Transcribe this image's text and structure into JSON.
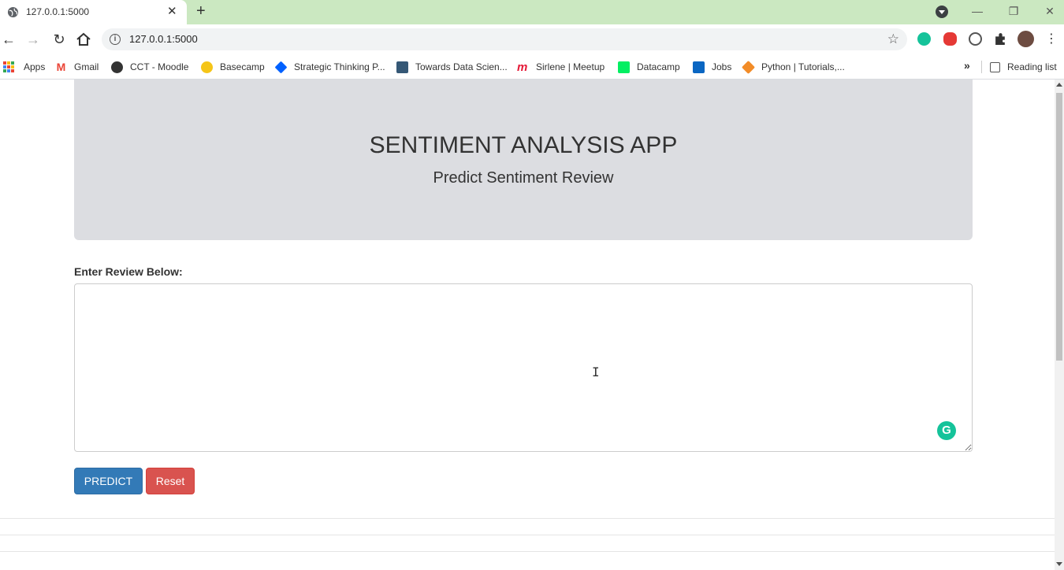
{
  "browser": {
    "tab_title": "127.0.0.1:5000",
    "url": "127.0.0.1:5000",
    "tab_close": "✕",
    "new_tab": "+",
    "window_buttons": {
      "minimize": "—",
      "restore": "❐",
      "close": "✕"
    }
  },
  "bookmarks": {
    "items": [
      {
        "label": "Apps",
        "icon": "apps-grid-icon",
        "color": "#4285f4"
      },
      {
        "label": "Gmail",
        "icon": "gmail-icon",
        "color": "#ea4335"
      },
      {
        "label": "CCT - Moodle",
        "icon": "moodle-icon",
        "color": "#333333"
      },
      {
        "label": "Basecamp",
        "icon": "basecamp-icon",
        "color": "#f5c518"
      },
      {
        "label": "Strategic Thinking P...",
        "icon": "dropbox-icon",
        "color": "#0061ff"
      },
      {
        "label": "Towards Data Scien...",
        "icon": "tds-icon",
        "color": "#355876"
      },
      {
        "label": "Sirlene | Meetup",
        "icon": "meetup-icon",
        "color": "#e51937"
      },
      {
        "label": "Datacamp",
        "icon": "datacamp-icon",
        "color": "#03ef62"
      },
      {
        "label": "Jobs",
        "icon": "linkedin-icon",
        "color": "#0a66c2"
      },
      {
        "label": "Python | Tutorials,...",
        "icon": "python-box-icon",
        "color": "#f28c28"
      }
    ],
    "more": "»",
    "reading_list": "Reading list"
  },
  "page": {
    "title": "SENTIMENT ANALYSIS APP",
    "subtitle": "Predict Sentiment Review",
    "review_label": "Enter Review Below:",
    "review_value": "",
    "predict_label": "PREDICT",
    "reset_label": "Reset"
  },
  "colors": {
    "jumbotron": "#dcdde1",
    "predict": "#337ab7",
    "reset": "#d9534f",
    "tabstrip": "#cbe8c1"
  }
}
